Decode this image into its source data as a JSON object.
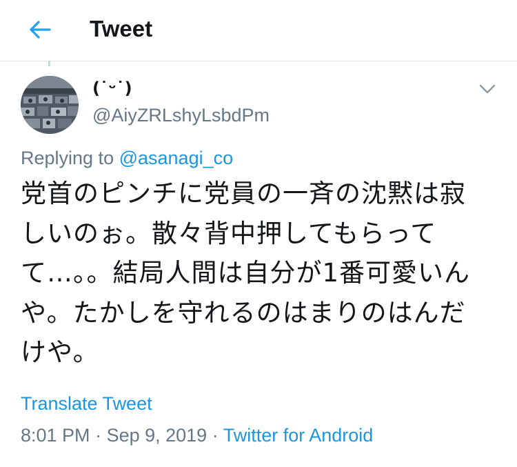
{
  "header": {
    "back_icon": "arrow-left-icon",
    "title": "Tweet",
    "accent_color": "#1da1f2"
  },
  "tweet": {
    "author": {
      "display_name": "(˙ᵕ˙)",
      "handle": "@AiyZRLshyLsbdPm",
      "avatar_icon": "profile-photo"
    },
    "menu_icon": "chevron-down-icon",
    "replying_prefix": "Replying to ",
    "replying_to": "@asanagi_co",
    "text_lines": [
      "党首のピンチに党員の一斉の沈黙は寂",
      "しいのぉ。散々背中押してもらって",
      "て…。。結局人間は自分が1番可愛いん",
      "や。たかしを守れるのはまりのはんだ",
      "けや。"
    ],
    "translate_label": "Translate Tweet",
    "time": "8:01 PM",
    "separator": " · ",
    "date": "Sep 9, 2019",
    "source": "Twitter for Android",
    "link_color": "#1b95e0",
    "muted_color": "#657786"
  }
}
